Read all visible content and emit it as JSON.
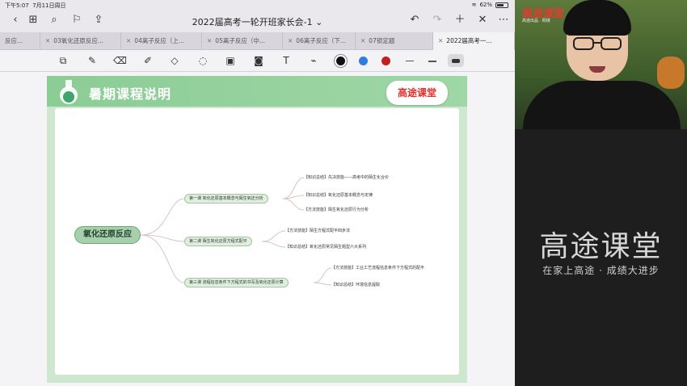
{
  "status": {
    "time": "下午5:07",
    "date": "7月11日周日",
    "battery": "62%"
  },
  "topbar": {
    "title": "2022届高考一轮开班家长会-1"
  },
  "tabs": [
    {
      "label": "反应..."
    },
    {
      "label": "03氧化还原反应..."
    },
    {
      "label": "04离子反应（上..."
    },
    {
      "label": "05离子反应（中..."
    },
    {
      "label": "06离子反应（下..."
    },
    {
      "label": "07锁定题"
    },
    {
      "label": "2022届高考一..."
    }
  ],
  "colors": {
    "accent_green": "#8ccc96",
    "brand_red": "#e0302d",
    "pen_black": "#111111",
    "pen_blue": "#2f7de1",
    "pen_red": "#c0201f"
  },
  "page": {
    "title": "暑期课程说明",
    "logo": "高途课堂"
  },
  "mindmap": {
    "root": "氧化还原反应",
    "branches": [
      {
        "label": "第一课 氧化还原基本概念与陌生氧还分析",
        "items": [
          "【知识总结】先决技能——高考中的陌生化合价",
          "【知识总结】氧化还原基本概念与定律",
          "【方法技能】陌生氧化还原行为分析"
        ]
      },
      {
        "label": "第二课 陌生氧化还原方程式配平",
        "items": [
          "【方法技能】陌生方程式配平四步法",
          "【知识总结】氧化还原常见陌生题型六大系列"
        ]
      },
      {
        "label": "第三课 流程信息条件下方程式的书写及氧化还原计算",
        "items": [
          "【方法技能】工业工艺流程信息条件下方程式的配平",
          "【知识总结】环境信息提取"
        ]
      }
    ]
  },
  "webcam": {
    "logo": "高途课堂",
    "sub": "高途出品 · 网课"
  },
  "brand": {
    "logo": "高途课堂",
    "slogan": "在家上高途 · 成绩大进步"
  }
}
